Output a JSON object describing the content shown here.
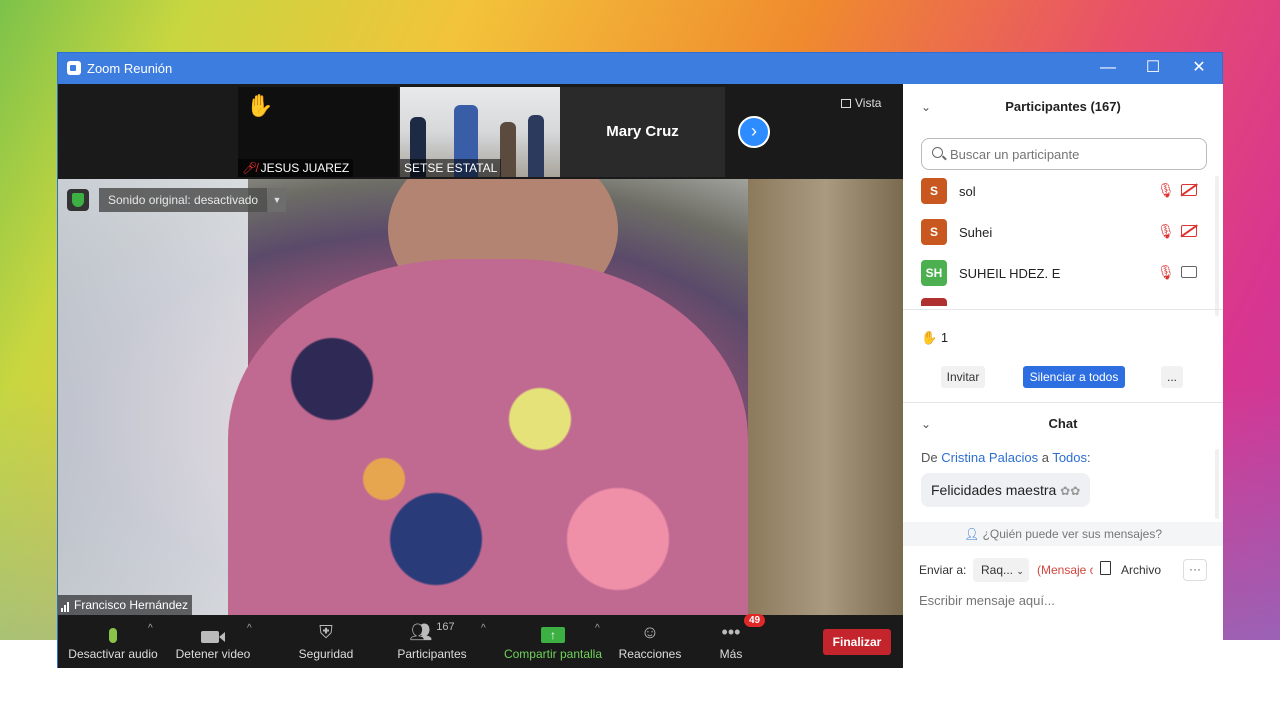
{
  "window": {
    "title": "Zoom Reunión",
    "minimize": "—",
    "maximize": "☐",
    "close": "✕"
  },
  "strip": {
    "thumbs": [
      {
        "name": "JESUS JUAREZ"
      },
      {
        "name": "SETSE ESTATAL"
      }
    ],
    "active_name": "Mary Cruz",
    "view_label": "Vista"
  },
  "main": {
    "original_sound": "Sonido original: desactivado",
    "speaker": "Francisco Hernández"
  },
  "toolbar": {
    "mute_label": "Desactivar audio",
    "video_label": "Detener video",
    "security_label": "Seguridad",
    "participants_label": "Participantes",
    "participants_count": "167",
    "share_label": "Compartir pantalla",
    "reactions_label": "Reacciones",
    "more_label": "Más",
    "more_badge": "49",
    "end_label": "Finalizar"
  },
  "participants": {
    "title": "Participantes (167)",
    "search_placeholder": "Buscar un participante",
    "list": [
      {
        "initials": "S",
        "name": "sol",
        "color": "#c8581f",
        "video": "off"
      },
      {
        "initials": "S",
        "name": "Suhei",
        "color": "#c8581f",
        "video": "off"
      },
      {
        "initials": "SH",
        "name": "SUHEIL HDEZ. E",
        "color": "#4caf50",
        "video": "on"
      }
    ],
    "raised_hands": "1",
    "invite_label": "Invitar",
    "mute_all_label": "Silenciar a todos",
    "more_label": "..."
  },
  "chat": {
    "title": "Chat",
    "from_prefix": "De",
    "sender": "Cristina Palacios",
    "to_prefix": "a",
    "recipient": "Todos",
    "message": "Felicidades maestra",
    "who_can_see": "¿Quién puede ver sus mensajes?",
    "send_to_label": "Enviar a:",
    "send_to_value": "Raq...",
    "private_note": "(Mensaje c",
    "file_label": "Archivo",
    "more_label": "···",
    "input_placeholder": "Escribir mensaje aquí..."
  }
}
